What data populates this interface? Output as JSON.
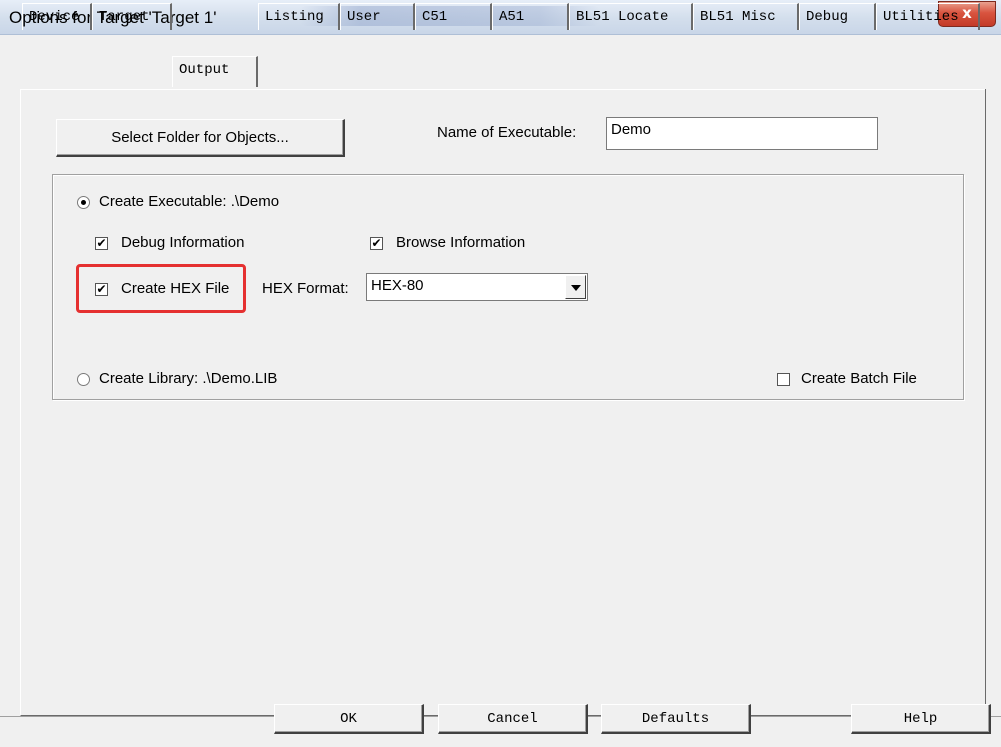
{
  "window": {
    "title": "Options for Target 'Target 1'",
    "close_glyph": "x"
  },
  "tabs": [
    {
      "label": "Device"
    },
    {
      "label": "Target"
    },
    {
      "label": "Output"
    },
    {
      "label": "Listing"
    },
    {
      "label": "User"
    },
    {
      "label": "C51"
    },
    {
      "label": "A51"
    },
    {
      "label": "BL51 Locate"
    },
    {
      "label": "BL51 Misc"
    },
    {
      "label": "Debug"
    },
    {
      "label": "Utilities"
    }
  ],
  "output": {
    "select_folder_label": "Select Folder for Objects...",
    "name_exe_label": "Name of Executable:",
    "name_exe_value": "Demo",
    "create_exe_label": "Create Executable:  .\\Demo",
    "create_exe_selected": true,
    "debug_info_label": "Debug Information",
    "debug_info_checked": true,
    "browse_info_label": "Browse Information",
    "browse_info_checked": true,
    "create_hex_label": "Create HEX File",
    "create_hex_checked": true,
    "hex_format_label": "HEX Format:",
    "hex_format_value": "HEX-80",
    "create_lib_label": "Create Library:  .\\Demo.LIB",
    "create_lib_selected": false,
    "batch_file_label": "Create Batch File",
    "batch_file_checked": false,
    "check_glyph": "✔",
    "highlight_color": "#e53030"
  },
  "footer": {
    "ok": "OK",
    "cancel": "Cancel",
    "defaults": "Defaults",
    "help": "Help"
  }
}
